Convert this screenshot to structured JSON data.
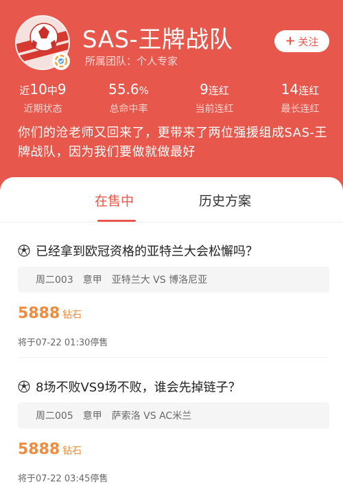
{
  "profile": {
    "name": "SAS-王牌战队",
    "affiliation": "所属团队：个人专家",
    "follow_label": "关注",
    "follow_icon": "plus-icon",
    "description": "你们的沧老师又回来了，更带来了两位强援组成SAS-王牌战队，因为我们要做就做最好"
  },
  "stats": [
    {
      "prefix": "近",
      "value": "10",
      "mid": "中",
      "value2": "9",
      "label": "近期状态"
    },
    {
      "value": "55.6",
      "suffix": "%",
      "label": "总命中率"
    },
    {
      "value": "9",
      "suffix": "连红",
      "label": "当前连红"
    },
    {
      "value": "14",
      "suffix": "连红",
      "label": "最长连红"
    }
  ],
  "tabs": [
    {
      "label": "在售中",
      "active": true
    },
    {
      "label": "历史方案",
      "active": false
    }
  ],
  "plans": [
    {
      "title": "已经拿到欧冠资格的亚特兰大会松懈吗？",
      "code": "周二003",
      "league": "意甲",
      "match": "亚特兰大 VS 博洛尼亚",
      "price": "5888",
      "unit": "钻石",
      "stop_time": "将于07-22 01:30停售"
    },
    {
      "title": "8场不败VS9场不败，谁会先掉链子？",
      "code": "周二005",
      "league": "意甲",
      "match": "萨索洛 VS AC米兰",
      "price": "5888",
      "unit": "钻石",
      "stop_time": "将于07-22 03:45停售"
    }
  ],
  "colors": {
    "brand": "#e8574b",
    "price": "#f08a3c"
  }
}
